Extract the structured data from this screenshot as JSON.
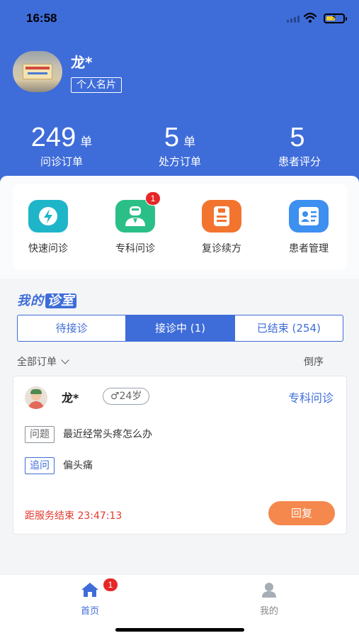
{
  "status_bar": {
    "time": "16:58"
  },
  "profile": {
    "name": "龙*",
    "card_button": "个人名片"
  },
  "stats": [
    {
      "value": "249",
      "unit": "单",
      "label": "问诊订单"
    },
    {
      "value": "5",
      "unit": "单",
      "label": "处方订单"
    },
    {
      "value": "5",
      "unit": "",
      "label": "患者评分"
    }
  ],
  "quick_actions": [
    {
      "label": "快速问诊",
      "icon": "lightning-icon",
      "color": "#1fb5c9",
      "badge": ""
    },
    {
      "label": "专科问诊",
      "icon": "doctor-icon",
      "color": "#2bbf88",
      "badge": "1"
    },
    {
      "label": "复诊续方",
      "icon": "prescription-icon",
      "color": "#f2742f",
      "badge": ""
    },
    {
      "label": "患者管理",
      "icon": "patient-card-icon",
      "color": "#3d8ff0",
      "badge": ""
    }
  ],
  "section": {
    "title_a": "我的",
    "title_b": "诊室"
  },
  "tabs": [
    {
      "label": "待接诊",
      "active": false
    },
    {
      "label": "接诊中 (1)",
      "active": true
    },
    {
      "label": "已结束 (254)",
      "active": false
    }
  ],
  "filter": {
    "label": "全部订单",
    "sort_label": "倒序"
  },
  "order": {
    "patient_name": "龙*",
    "patient_info": "♂24岁",
    "type": "专科问诊",
    "question_label": "问题",
    "question_text": "最近经常头疼怎么办",
    "followup_label": "追问",
    "followup_text": "偏头痛",
    "countdown": "距服务结束 23:47:13",
    "reply_label": "回复"
  },
  "tabbar": [
    {
      "label": "首页",
      "icon": "home-icon",
      "active": true,
      "badge": "1"
    },
    {
      "label": "我的",
      "icon": "person-icon",
      "active": false,
      "badge": ""
    }
  ],
  "colors": {
    "primary": "#3e6cd9",
    "danger": "#e23a2e",
    "reply": "#f4884d"
  }
}
